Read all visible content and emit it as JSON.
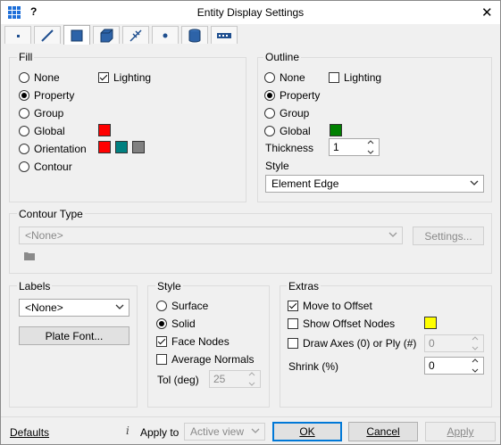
{
  "window": {
    "title": "Entity Display Settings",
    "help_glyph": "?",
    "close_glyph": "✕"
  },
  "tabs": [
    {
      "name": "point-icon"
    },
    {
      "name": "line-icon"
    },
    {
      "name": "plate-icon"
    },
    {
      "name": "solid-icon"
    },
    {
      "name": "link-icon"
    },
    {
      "name": "node-icon"
    },
    {
      "name": "cylinder-icon"
    },
    {
      "name": "dotted-icon"
    }
  ],
  "fill": {
    "label": "Fill",
    "options": [
      "None",
      "Property",
      "Group",
      "Global",
      "Orientation",
      "Contour"
    ],
    "selected": "Property",
    "lighting_label": "Lighting",
    "lighting_checked": true,
    "global_color": "#ff0000",
    "orientation_colors": [
      "#ff0000",
      "#008080",
      "#808080"
    ]
  },
  "outline": {
    "label": "Outline",
    "options": [
      "None",
      "Property",
      "Group",
      "Global"
    ],
    "selected": "Property",
    "lighting_label": "Lighting",
    "lighting_checked": false,
    "global_color": "#008000",
    "thickness_label": "Thickness",
    "thickness_value": "1",
    "style_label": "Style",
    "style_value": "Element Edge"
  },
  "contour_type": {
    "label": "Contour Type",
    "value": "<None>",
    "settings_label": "Settings..."
  },
  "labels": {
    "label": "Labels",
    "value": "<None>",
    "plate_font_label": "Plate Font..."
  },
  "style": {
    "label": "Style",
    "options": [
      "Surface",
      "Solid"
    ],
    "selected": "Solid",
    "face_nodes_label": "Face Nodes",
    "face_nodes_checked": true,
    "average_normals_label": "Average Normals",
    "average_normals_checked": false,
    "tol_label": "Tol (deg)",
    "tol_value": "25"
  },
  "extras": {
    "label": "Extras",
    "move_to_offset_label": "Move to Offset",
    "move_to_offset_checked": true,
    "show_offset_nodes_label": "Show Offset Nodes",
    "show_offset_nodes_checked": false,
    "offset_color": "#ffff00",
    "draw_axes_label": "Draw Axes (0) or Ply (#)",
    "draw_axes_checked": false,
    "draw_axes_value": "0",
    "shrink_label": "Shrink (%)",
    "shrink_value": "0"
  },
  "footer": {
    "defaults_label": "Defaults",
    "info_glyph": "i",
    "apply_to_label": "Apply to",
    "apply_to_value": "Active view",
    "ok_label": "OK",
    "cancel_label": "Cancel",
    "apply_label": "Apply"
  }
}
